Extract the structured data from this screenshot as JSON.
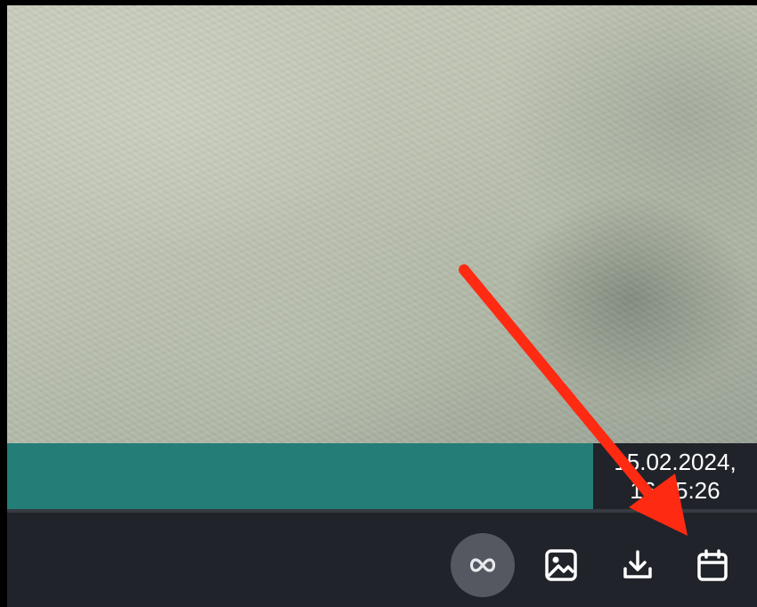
{
  "player": {
    "timestamp_line1": "15.02.2024,",
    "timestamp_line2": "16:45:26"
  },
  "toolbar": {
    "buttons": [
      {
        "name": "loop",
        "icon": "infinity-icon",
        "active": true
      },
      {
        "name": "snapshot",
        "icon": "image-icon",
        "active": false
      },
      {
        "name": "download",
        "icon": "download-icon",
        "active": false
      },
      {
        "name": "calendar",
        "icon": "calendar-icon",
        "active": false
      }
    ]
  },
  "annotation": {
    "arrow_color": "#ff2a12",
    "points_to": "calendar-button"
  },
  "colors": {
    "toolbar_bg": "#202329",
    "timeline_fill": "#257d77",
    "active_button_bg": "#555861",
    "icon": "#ffffff"
  }
}
